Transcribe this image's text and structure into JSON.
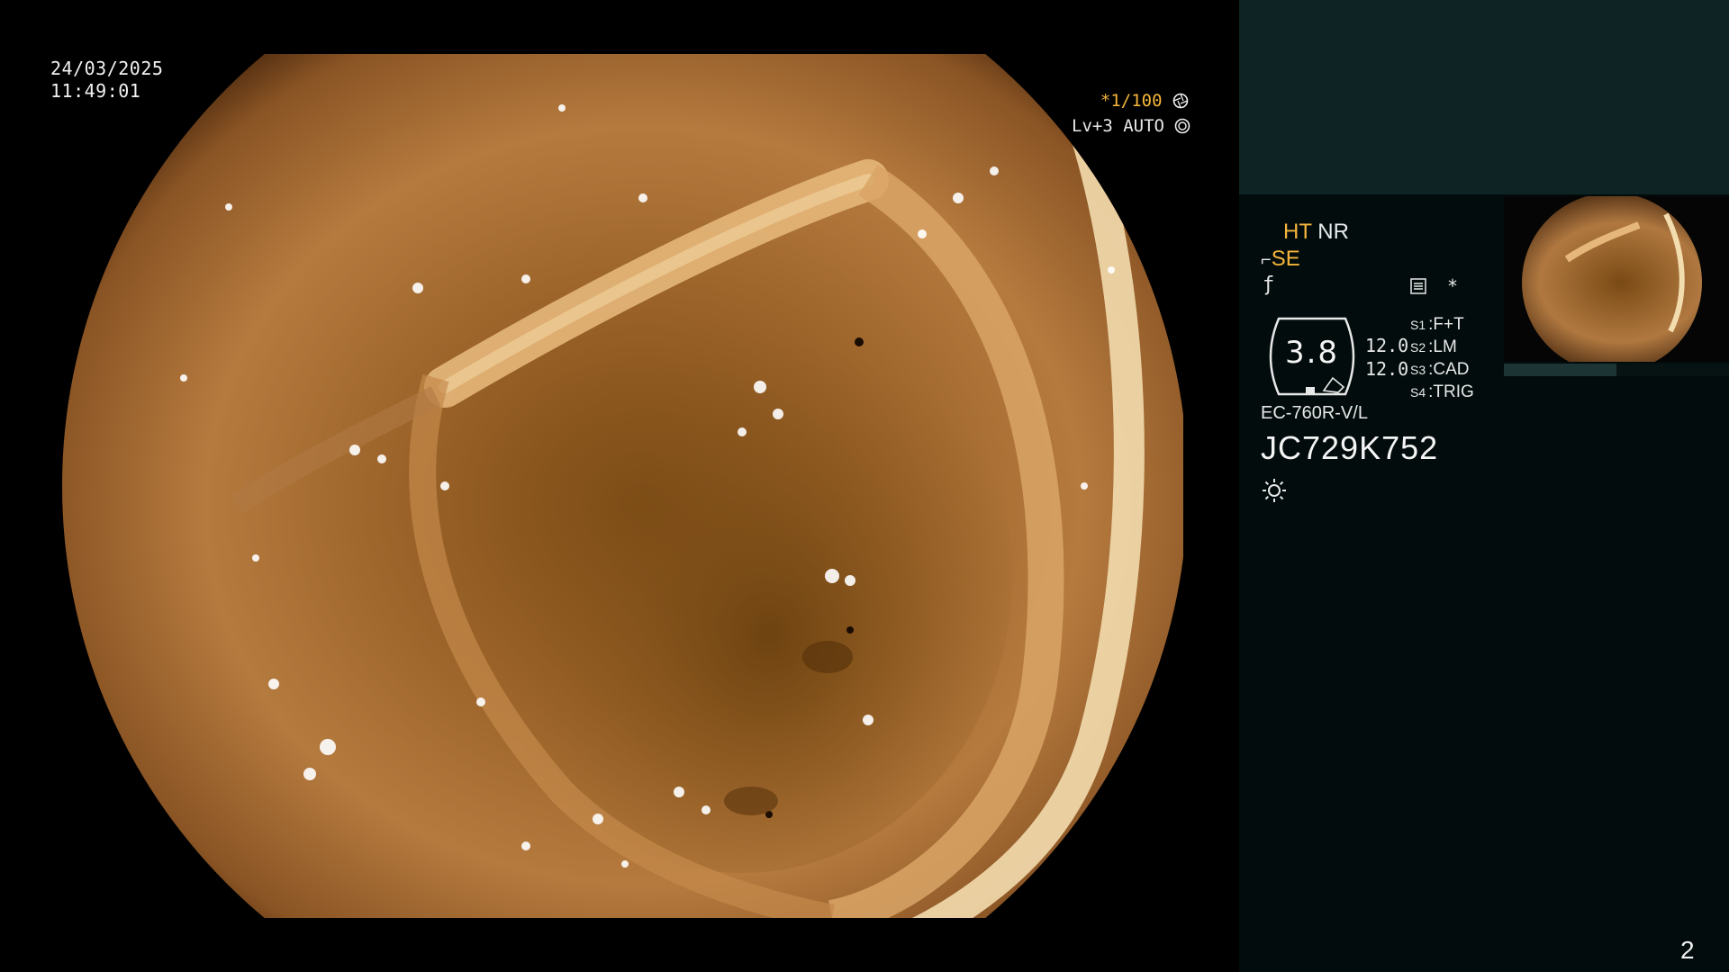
{
  "osd": {
    "date": "24/03/2025",
    "time": "11:49:01",
    "shutter_ratio": "*1/100",
    "level": "Lv+3 AUTO"
  },
  "panel": {
    "mode_ht": "HT",
    "mode_nr": "NR",
    "mode_se": "SE",
    "memo_star": "*",
    "gauge_value": "3.8",
    "value_upper": "12.0",
    "value_lower": "12.0",
    "switches": [
      {
        "key": "S1",
        "value": "F+T"
      },
      {
        "key": "S2",
        "value": "LM"
      },
      {
        "key": "S3",
        "value": "CAD"
      },
      {
        "key": "S4",
        "value": "TRIG"
      }
    ],
    "scope_model": "EC-760R-V/L",
    "serial": "JC729K752",
    "page_number": "2"
  },
  "colors": {
    "accent": "#f5b53b",
    "panel_bg": "#020c0c",
    "panel_top": "#0e2424",
    "text": "#e8ecec"
  },
  "icons": [
    "shutter-icon",
    "auto-iris-icon",
    "scope-hook-icon",
    "curve-icon",
    "memo-icon",
    "brightness-sun-icon"
  ]
}
